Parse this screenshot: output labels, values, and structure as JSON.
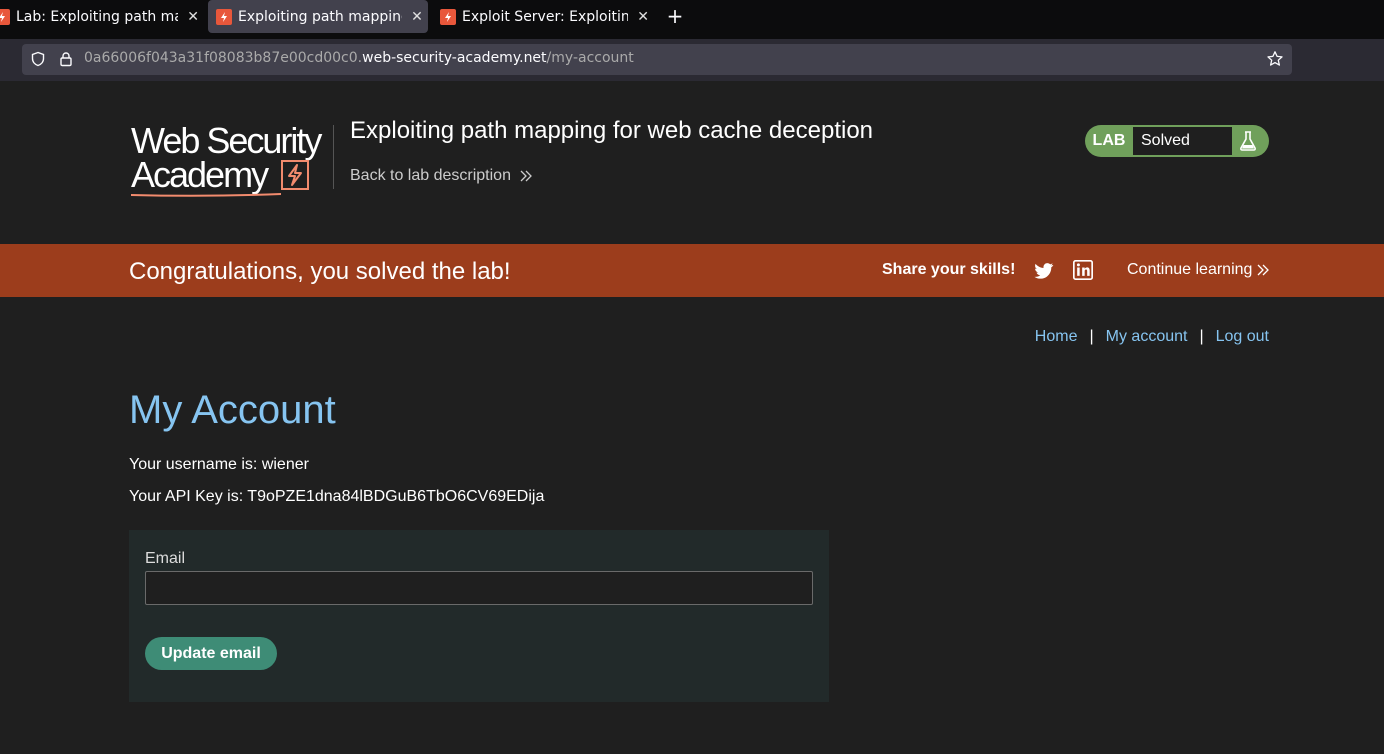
{
  "browser": {
    "tabs": [
      {
        "title": "Lab: Exploiting path map",
        "active": false
      },
      {
        "title": "Exploiting path mapping",
        "active": true
      },
      {
        "title": "Exploit Server: Exploiting",
        "active": false
      }
    ],
    "close_glyph": "✕",
    "new_tab_glyph": "+",
    "url_prefix": "0a66006f043a31f08083b87e00cd00c0.",
    "url_host": "web-security-academy.net",
    "url_path": "/my-account"
  },
  "header": {
    "logo_line1": "Web Security",
    "logo_line2": "Academy",
    "lab_title": "Exploiting path mapping for web cache deception",
    "back_link": "Back to lab description",
    "lab_label": "LAB",
    "lab_status": "Solved"
  },
  "banner": {
    "congrats": "Congratulations, you solved the lab!",
    "share": "Share your skills!",
    "continue": "Continue learning"
  },
  "nav": {
    "home": "Home",
    "my_account": "My account",
    "logout": "Log out",
    "separator": "|"
  },
  "main": {
    "title": "My Account",
    "username_text": "Your username is: wiener",
    "api_key_text": "Your API Key is: T9oPZE1dna84lBDGuB6TbO6CV69EDija",
    "email_label": "Email",
    "email_value": "",
    "update_button": "Update email"
  },
  "colors": {
    "accent_blue": "#86c4f0",
    "banner_orange": "#9c3d1c",
    "lab_green": "#70a05b",
    "button_green": "#3e8c76",
    "favicon_orange": "#e8573b"
  }
}
